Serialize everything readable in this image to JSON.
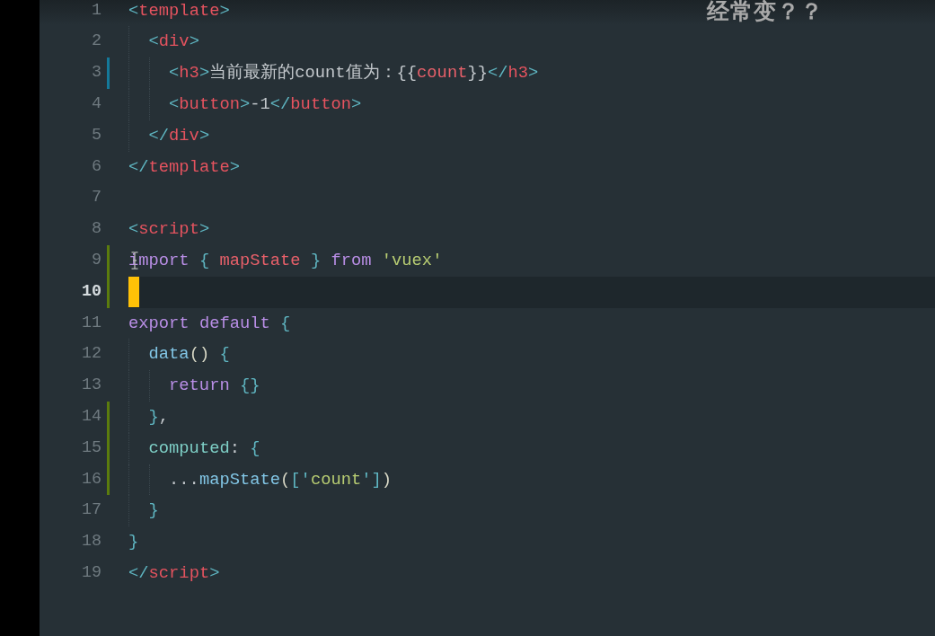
{
  "caption": "经常变？？",
  "editor": {
    "lines": [
      {
        "number": "1",
        "modified": false,
        "added": false,
        "current": false,
        "pointer": false,
        "tokens": [
          {
            "kind": "punct",
            "text": "<"
          },
          {
            "kind": "tag",
            "text": "template"
          },
          {
            "kind": "punct",
            "text": ">"
          }
        ]
      },
      {
        "number": "2",
        "modified": false,
        "added": false,
        "current": false,
        "pointer": false,
        "tokens": [
          {
            "kind": "punct",
            "text": "  <"
          },
          {
            "kind": "tag",
            "text": "div"
          },
          {
            "kind": "punct",
            "text": ">"
          }
        ]
      },
      {
        "number": "3",
        "modified": true,
        "added": false,
        "current": false,
        "pointer": false,
        "tokens": [
          {
            "kind": "punct",
            "text": "    <"
          },
          {
            "kind": "tag",
            "text": "h3"
          },
          {
            "kind": "punct",
            "text": ">"
          },
          {
            "kind": "plain",
            "text": "当前最新的count值为：{{"
          },
          {
            "kind": "variable",
            "text": "count"
          },
          {
            "kind": "plain",
            "text": "}}"
          },
          {
            "kind": "punct",
            "text": "</"
          },
          {
            "kind": "tag",
            "text": "h3"
          },
          {
            "kind": "punct",
            "text": ">"
          }
        ]
      },
      {
        "number": "4",
        "modified": false,
        "added": false,
        "current": false,
        "pointer": false,
        "tokens": [
          {
            "kind": "punct",
            "text": "    <"
          },
          {
            "kind": "tag",
            "text": "button"
          },
          {
            "kind": "punct",
            "text": ">"
          },
          {
            "kind": "plain",
            "text": "-1"
          },
          {
            "kind": "punct",
            "text": "</"
          },
          {
            "kind": "tag",
            "text": "button"
          },
          {
            "kind": "punct",
            "text": ">"
          }
        ]
      },
      {
        "number": "5",
        "modified": false,
        "added": false,
        "current": false,
        "pointer": false,
        "tokens": [
          {
            "kind": "punct",
            "text": "  </"
          },
          {
            "kind": "tag",
            "text": "div"
          },
          {
            "kind": "punct",
            "text": ">"
          }
        ]
      },
      {
        "number": "6",
        "modified": false,
        "added": false,
        "current": false,
        "pointer": false,
        "tokens": [
          {
            "kind": "punct",
            "text": "</"
          },
          {
            "kind": "tag",
            "text": "template"
          },
          {
            "kind": "punct",
            "text": ">"
          }
        ]
      },
      {
        "number": "7",
        "modified": false,
        "added": false,
        "current": false,
        "pointer": false
      },
      {
        "number": "8",
        "modified": false,
        "added": false,
        "current": false,
        "pointer": false,
        "tokens": [
          {
            "kind": "punct",
            "text": "<"
          },
          {
            "kind": "tag",
            "text": "script"
          },
          {
            "kind": "punct",
            "text": ">"
          }
        ]
      },
      {
        "number": "9",
        "modified": false,
        "added": true,
        "current": false,
        "pointer": true,
        "tokens": [
          {
            "kind": "keyword",
            "text": "import"
          },
          {
            "kind": "punct",
            "text": " {"
          },
          {
            "kind": "variable",
            "text": " mapState"
          },
          {
            "kind": "punct",
            "text": " }"
          },
          {
            "kind": "keyword",
            "text": " from"
          },
          {
            "kind": "string",
            "text": " 'vuex'"
          }
        ]
      },
      {
        "number": "10",
        "modified": false,
        "added": true,
        "current": true,
        "pointer": false
      },
      {
        "number": "11",
        "modified": false,
        "added": false,
        "current": false,
        "pointer": false,
        "tokens": [
          {
            "kind": "keyword",
            "text": "export default"
          },
          {
            "kind": "punct",
            "text": " {"
          }
        ]
      },
      {
        "number": "12",
        "modified": false,
        "added": false,
        "current": false,
        "pointer": false,
        "tokens": [
          {
            "kind": "function",
            "text": "  data"
          },
          {
            "kind": "paren",
            "text": "()"
          },
          {
            "kind": "punct",
            "text": " {"
          }
        ]
      },
      {
        "number": "13",
        "modified": false,
        "added": false,
        "current": false,
        "pointer": false,
        "tokens": [
          {
            "kind": "keyword",
            "text": "    return"
          },
          {
            "kind": "punct",
            "text": " {}"
          }
        ]
      },
      {
        "number": "14",
        "modified": false,
        "added": true,
        "current": false,
        "pointer": false,
        "tokens": [
          {
            "kind": "punct",
            "text": "  }"
          },
          {
            "kind": "plain",
            "text": ","
          }
        ]
      },
      {
        "number": "15",
        "modified": false,
        "added": true,
        "current": false,
        "pointer": false,
        "tokens": [
          {
            "kind": "property",
            "text": "  computed"
          },
          {
            "kind": "plain",
            "text": ":"
          },
          {
            "kind": "punct",
            "text": " {"
          }
        ]
      },
      {
        "number": "16",
        "modified": false,
        "added": true,
        "current": false,
        "pointer": false,
        "tokens": [
          {
            "kind": "plain",
            "text": "    ..."
          },
          {
            "kind": "function",
            "text": "mapState"
          },
          {
            "kind": "paren",
            "text": "("
          },
          {
            "kind": "punct",
            "text": "['"
          },
          {
            "kind": "string",
            "text": "count"
          },
          {
            "kind": "punct",
            "text": "']"
          },
          {
            "kind": "paren",
            "text": ")"
          }
        ]
      },
      {
        "number": "17",
        "modified": false,
        "added": false,
        "current": false,
        "pointer": false,
        "tokens": [
          {
            "kind": "punct",
            "text": "  }"
          }
        ]
      },
      {
        "number": "18",
        "modified": false,
        "added": false,
        "current": false,
        "pointer": false,
        "tokens": [
          {
            "kind": "punct",
            "text": "}"
          }
        ]
      },
      {
        "number": "19",
        "modified": false,
        "added": false,
        "current": false,
        "pointer": false,
        "tokens": [
          {
            "kind": "punct",
            "text": "</"
          },
          {
            "kind": "tag",
            "text": "script"
          },
          {
            "kind": "punct",
            "text": ">"
          }
        ]
      }
    ]
  }
}
